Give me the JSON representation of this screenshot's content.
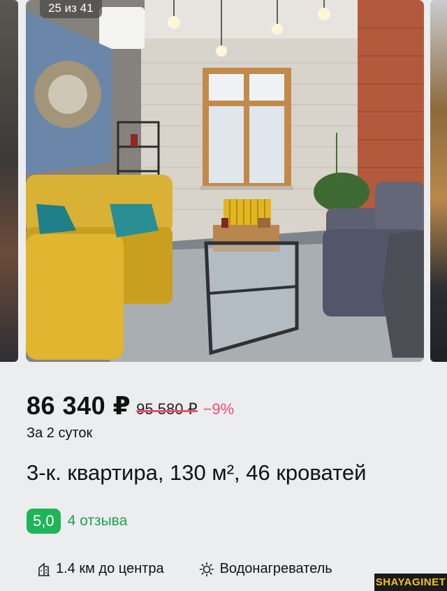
{
  "gallery": {
    "counter": "25 из 41",
    "photo_description": "apartment-living-room-photo"
  },
  "listing": {
    "price": "86 340 ₽",
    "old_price": "95 580 ₽",
    "discount": "−9%",
    "duration": "За 2 суток",
    "title": "3-к. квартира, 130 м², 46 кроватей",
    "rating": "5,0",
    "reviews": "4 отзыва"
  },
  "features": [
    {
      "icon": "building-icon",
      "label": "1.4 км до центра"
    },
    {
      "icon": "sun-icon",
      "label": "Водонагреватель"
    }
  ],
  "watermark": "SHAYAGINET",
  "colors": {
    "background": "#ecedef",
    "discount": "#ef4d6a",
    "rating_badge": "#1fb45a",
    "reviews": "#1aa451"
  }
}
